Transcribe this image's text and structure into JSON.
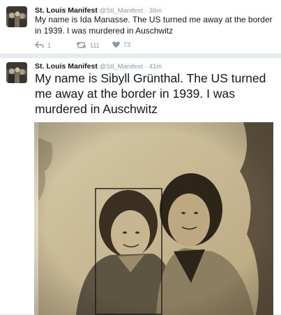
{
  "tweets": [
    {
      "name": "St. Louis Manifest",
      "handle": "@Stl_Manifest",
      "separator": "·",
      "time": "36m",
      "text": "My name is Ida Manasse. The US turned me away at the border in 1939. I was murdered in Auschwitz",
      "actions": {
        "reply": "1",
        "retweet": "111",
        "like": "73"
      }
    },
    {
      "name": "St. Louis Manifest",
      "handle": "@Stl_Manifest",
      "separator": "·",
      "time": "41m",
      "text": "My name is Sibyll Grünthal. The US turned me away at the border in 1939. I was murdered in Auschwitz"
    }
  ],
  "icons": {
    "avatar": "avatar-photo",
    "reply": "reply-icon",
    "retweet": "retweet-icon",
    "like": "heart-icon"
  },
  "colors": {
    "name_text": "#14171a",
    "meta_text": "#8899a6",
    "background": "#e6ecf0",
    "photo_sepia": "#c9b891"
  }
}
